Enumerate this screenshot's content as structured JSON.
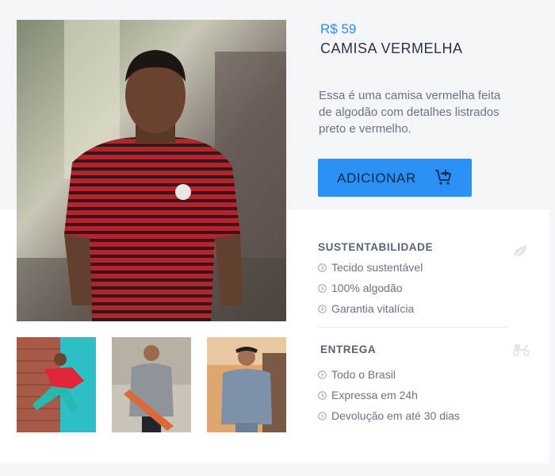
{
  "product": {
    "price": "R$ 59",
    "title": "CAMISA VERMELHA",
    "description": "Essa é uma camisa vermelha feita de algodão com detalhes listrados preto e vermelho.",
    "add_button_label": "ADICIONAR",
    "accent_color": "#2a90f5",
    "price_color": "#2a8cf0"
  },
  "images": {
    "main": "man-in-red-striped-tshirt",
    "thumbnails": [
      "red-jacket-skater",
      "grey-shirt-skateboard",
      "denim-jacket-man"
    ]
  },
  "features": {
    "sustainability": {
      "title": "SUSTENTABILIDADE",
      "icon": "leaf-icon",
      "items": [
        "Tecido sustentável",
        "100% algodão",
        "Garantia vitalícia"
      ]
    },
    "delivery": {
      "title": "ENTREGA",
      "icon": "scooter-icon",
      "items": [
        "Todo o Brasil",
        "Expressa em 24h",
        "Devolução em até 30 dias"
      ]
    }
  }
}
